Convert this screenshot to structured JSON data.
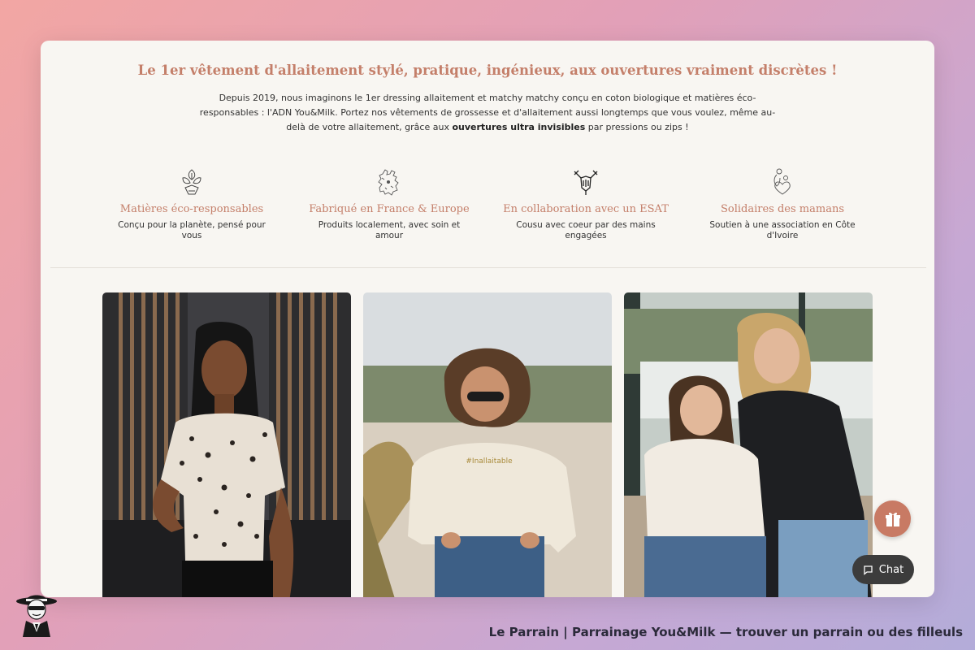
{
  "headline": "Le 1er vêtement d'allaitement stylé, pratique, ingénieux, aux ouvertures vraiment discrètes !",
  "intro": {
    "part1": "Depuis 2019, nous imaginons le 1er dressing allaitement et matchy matchy conçu en coton biologique et matières éco-responsables : l'ADN You&Milk. Portez nos vêtements de grossesse et d'allaitement aussi longtemps que vous voulez, même au-delà de votre allaitement, grâce aux ",
    "bold": "ouvertures ultra invisibles",
    "part2": " par pressions ou zips !"
  },
  "features": [
    {
      "icon": "recycle-leaves-icon",
      "title": "Matières éco-responsables",
      "desc": "Conçu pour la planète, pensé pour vous"
    },
    {
      "icon": "europe-map-icon",
      "title": "Fabriqué en France & Europe",
      "desc": "Produits localement, avec soin et amour"
    },
    {
      "icon": "handshake-icon",
      "title": "En collaboration avec un ESAT",
      "desc": "Cousu avec coeur par des mains engagées"
    },
    {
      "icon": "mother-child-heart-icon",
      "title": "Solidaires des mamans",
      "desc": "Soutien à une association en Côte d'Ivoire"
    }
  ],
  "photos": [
    {
      "name": "photo-leopard-tee"
    },
    {
      "name": "photo-sweatshirt"
    },
    {
      "name": "photo-two-women"
    }
  ],
  "sweatshirt_text": "#Inallaitable",
  "chat": {
    "label": "Chat",
    "icon": "chat-bubble-icon"
  },
  "gift": {
    "icon": "gift-icon"
  },
  "footer": {
    "caption": "Le Parrain | Parrainage You&Milk — trouver un parrain ou des filleuls"
  },
  "colors": {
    "accent": "#c47f6a",
    "card": "#f8f6f2",
    "chat_bg": "#3c3c3c",
    "gift_bg": "#c87a64"
  }
}
